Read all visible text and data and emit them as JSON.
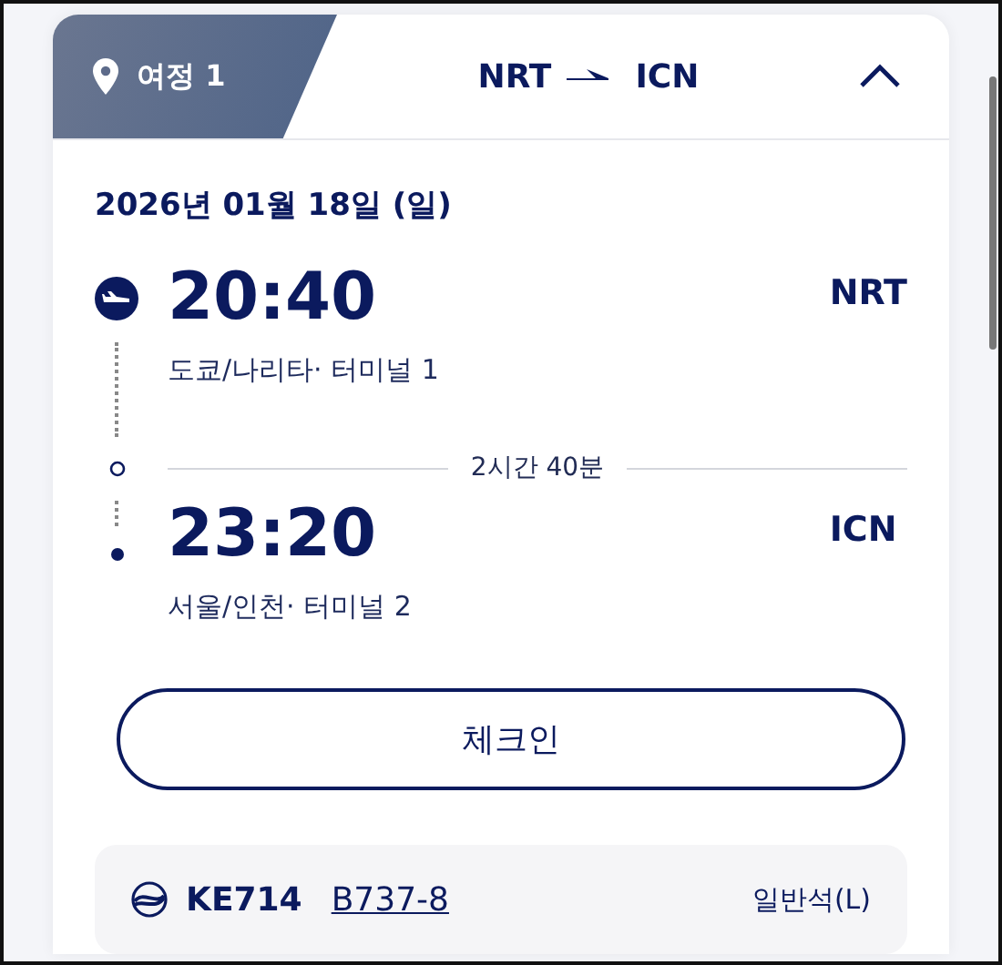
{
  "trip_tab": {
    "label": "여정 1",
    "selected": true
  },
  "route": {
    "origin": "NRT",
    "destination": "ICN"
  },
  "expanded": true,
  "date": "2026년 01월 18일 (일)",
  "departure": {
    "time": "20:40",
    "airport_code": "NRT",
    "terminal": "도쿄/나리타· 터미널  1"
  },
  "duration": "2시간 40분",
  "arrival": {
    "time": "23:20",
    "airport_code": "ICN",
    "terminal": "서울/인천· 터미널  2"
  },
  "checkin_button": "체크인",
  "flight": {
    "number": "KE714",
    "aircraft": "B737-8",
    "cabin": "일반석(L)"
  }
}
